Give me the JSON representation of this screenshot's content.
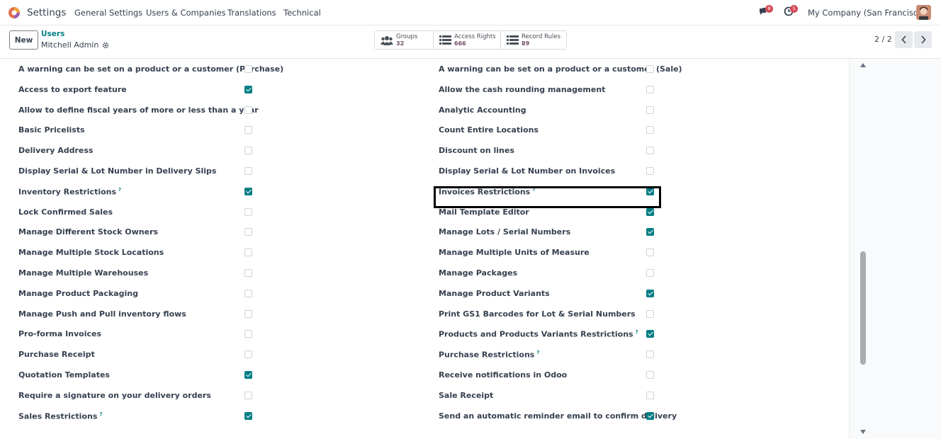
{
  "navbar": {
    "app_name": "Settings",
    "menu": [
      "General Settings",
      "Users & Companies",
      "Translations",
      "Technical"
    ],
    "messages_count": "8",
    "activities_count": "5",
    "company": "My Company (San Francisco)"
  },
  "control_panel": {
    "new_label": "New",
    "breadcrumb_parent": "Users",
    "breadcrumb_current": "Mitchell Admin",
    "smart_buttons": [
      {
        "label": "Groups",
        "value": "32",
        "icon": "users-icon"
      },
      {
        "label": "Access Rights",
        "value": "666",
        "icon": "list-icon"
      },
      {
        "label": "Record Rules",
        "value": "89",
        "icon": "list-icon"
      }
    ],
    "pager": "2 / 2"
  },
  "left_column": [
    {
      "label": "A warning can be set on a product or a customer (Purchase)",
      "checked": false,
      "help": false
    },
    {
      "label": "Access to export feature",
      "checked": true,
      "help": false
    },
    {
      "label": "Allow to define fiscal years of more or less than a year",
      "checked": false,
      "help": false
    },
    {
      "label": "Basic Pricelists",
      "checked": false,
      "help": false
    },
    {
      "label": "Delivery Address",
      "checked": false,
      "help": false
    },
    {
      "label": "Display Serial & Lot Number in Delivery Slips",
      "checked": false,
      "help": false
    },
    {
      "label": "Inventory Restrictions",
      "checked": true,
      "help": true
    },
    {
      "label": "Lock Confirmed Sales",
      "checked": false,
      "help": false
    },
    {
      "label": "Manage Different Stock Owners",
      "checked": false,
      "help": false
    },
    {
      "label": "Manage Multiple Stock Locations",
      "checked": false,
      "help": false
    },
    {
      "label": "Manage Multiple Warehouses",
      "checked": false,
      "help": false
    },
    {
      "label": "Manage Product Packaging",
      "checked": false,
      "help": false
    },
    {
      "label": "Manage Push and Pull inventory flows",
      "checked": false,
      "help": false
    },
    {
      "label": "Pro-forma Invoices",
      "checked": false,
      "help": false
    },
    {
      "label": "Purchase Receipt",
      "checked": false,
      "help": false
    },
    {
      "label": "Quotation Templates",
      "checked": true,
      "help": false
    },
    {
      "label": "Require a signature on your delivery orders",
      "checked": false,
      "help": false
    },
    {
      "label": "Sales Restrictions",
      "checked": true,
      "help": true
    }
  ],
  "right_column": [
    {
      "label": "A warning can be set on a product or a customer (Sale)",
      "checked": false,
      "help": false
    },
    {
      "label": "Allow the cash rounding management",
      "checked": false,
      "help": false
    },
    {
      "label": "Analytic Accounting",
      "checked": false,
      "help": false
    },
    {
      "label": "Count Entire Locations",
      "checked": false,
      "help": false
    },
    {
      "label": "Discount on lines",
      "checked": false,
      "help": false
    },
    {
      "label": "Display Serial & Lot Number on Invoices",
      "checked": false,
      "help": false
    },
    {
      "label": "Invoices Restrictions",
      "checked": true,
      "help": true
    },
    {
      "label": "Mail Template Editor",
      "checked": true,
      "help": false
    },
    {
      "label": "Manage Lots / Serial Numbers",
      "checked": true,
      "help": false
    },
    {
      "label": "Manage Multiple Units of Measure",
      "checked": false,
      "help": false
    },
    {
      "label": "Manage Packages",
      "checked": false,
      "help": false
    },
    {
      "label": "Manage Product Variants",
      "checked": true,
      "help": false
    },
    {
      "label": "Print GS1 Barcodes for Lot & Serial Numbers",
      "checked": false,
      "help": false
    },
    {
      "label": "Products and Products Variants Restrictions",
      "checked": true,
      "help": true
    },
    {
      "label": "Purchase Restrictions",
      "checked": false,
      "help": true
    },
    {
      "label": "Receive notifications in Odoo",
      "checked": false,
      "help": false
    },
    {
      "label": "Sale Receipt",
      "checked": false,
      "help": false
    },
    {
      "label": "Send an automatic reminder email to confirm delivery",
      "checked": true,
      "help": false
    }
  ],
  "help_mark": "?"
}
